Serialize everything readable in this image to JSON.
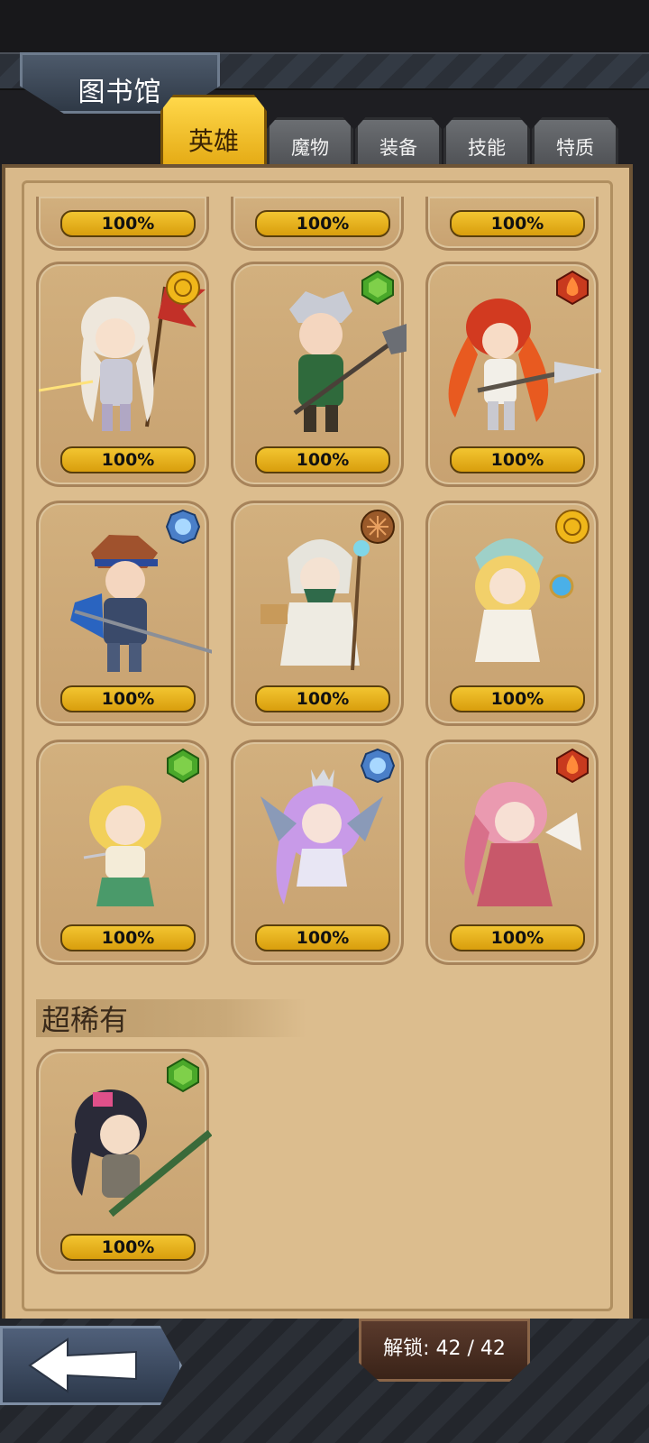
{
  "header": {
    "title": "图书馆"
  },
  "tabs": [
    {
      "label": "英雄",
      "active": true
    },
    {
      "label": "魔物",
      "active": false
    },
    {
      "label": "装备",
      "active": false
    },
    {
      "label": "技能",
      "active": false
    },
    {
      "label": "特质",
      "active": false
    }
  ],
  "partial_row": [
    {
      "progress": "100%"
    },
    {
      "progress": "100%"
    },
    {
      "progress": "100%"
    }
  ],
  "heroes": [
    {
      "progress": "100%",
      "element": "light-sun-icon"
    },
    {
      "progress": "100%",
      "element": "nature-leaf-icon"
    },
    {
      "progress": "100%",
      "element": "fire-flame-icon"
    },
    {
      "progress": "100%",
      "element": "water-frost-icon"
    },
    {
      "progress": "100%",
      "element": "earth-rune-icon"
    },
    {
      "progress": "100%",
      "element": "light-sun-icon"
    },
    {
      "progress": "100%",
      "element": "nature-leaf-icon"
    },
    {
      "progress": "100%",
      "element": "water-frost-icon"
    },
    {
      "progress": "100%",
      "element": "fire-flame-icon"
    }
  ],
  "section": {
    "title": "超稀有"
  },
  "super_rare": [
    {
      "progress": "100%",
      "element": "nature-leaf-icon"
    }
  ],
  "footer": {
    "unlock_text": "解锁: 42 / 42"
  },
  "colors": {
    "tab_active": "#f2c531",
    "progress_bar": "#e2ad18",
    "panel": "#d9b98a",
    "light": "#f0b71a",
    "nature": "#4aa82a",
    "fire": "#c83a1e",
    "water": "#4a7fc8",
    "earth": "#9a5a2a"
  }
}
